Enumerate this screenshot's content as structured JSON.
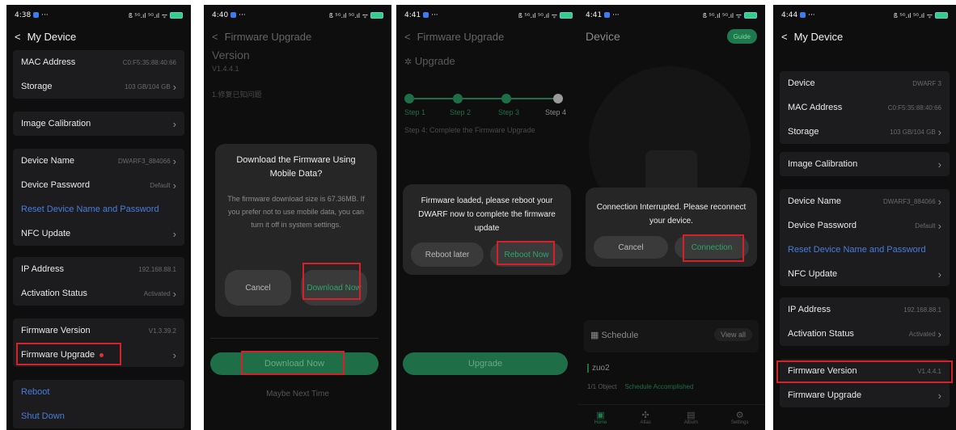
{
  "p1": {
    "time": "4:38",
    "status_right": "ß ⁵ᴳ.ıl ⁵ᴳ.ıl ᯤ",
    "title": "My Device",
    "mac_label": "MAC Address",
    "mac_value": "C0:F5:35:88:40:66",
    "storage_label": "Storage",
    "storage_value": "103 GB/104 GB",
    "calib_label": "Image Calibration",
    "devname_label": "Device Name",
    "devname_value": "DWARF3_884066",
    "devpw_label": "Device Password",
    "devpw_value": "Default",
    "reset_label": "Reset Device Name and Password",
    "nfc_label": "NFC Update",
    "ip_label": "IP Address",
    "ip_value": "192.168.88.1",
    "act_label": "Activation Status",
    "act_value": "Activated",
    "fwver_label": "Firmware Version",
    "fwver_value": "V1.3.39.2",
    "fwup_label": "Firmware Upgrade",
    "reboot_label": "Reboot",
    "shutdown_label": "Shut Down"
  },
  "p2": {
    "time": "4:40",
    "status_right": "ß ⁵ᴳ.ıl ⁵ᴳ.ıl ᯤ",
    "title": "Firmware Upgrade",
    "version_label": "Version",
    "version_value": "V1.4.4.1",
    "note": "1.修复已知问题",
    "dialog_title": "Download the Firmware Using Mobile Data?",
    "dialog_body": "The firmware download size is 67.36MB. If you prefer not to use mobile data, you can turn it off in system settings.",
    "cancel": "Cancel",
    "download_now_dialog": "Download Now",
    "download_now": "Download Now",
    "maybe": "Maybe Next Time"
  },
  "p3": {
    "time": "4:41",
    "status_right": "ß ⁵ᴳ.ıl ⁵ᴳ.ıl ᯤ",
    "title": "Firmware Upgrade",
    "upgrade_heading": "Upgrade",
    "steps": [
      "Step 1",
      "Step 2",
      "Step 3",
      "Step 4"
    ],
    "step_desc": "Step 4: Complete the Firmware Upgrade",
    "dialog_text": "Firmware loaded, please reboot your DWARF now to complete the firmware update",
    "reboot_later": "Reboot later",
    "reboot_now": "Reboot Now",
    "upgrade_btn": "Upgrade"
  },
  "p4": {
    "time": "4:41",
    "status_right": "ß ⁵ᴳ.ıl ⁵ᴳ.ıl ᯤ",
    "title": "Device",
    "guide": "Guide",
    "dialog_text": "Connection Interrupted. Please reconnect your device.",
    "cancel": "Cancel",
    "connection": "Connection",
    "schedule": "Schedule",
    "view_all": "View all",
    "item_name": "zuo2",
    "item_obj": "1/1 Object",
    "item_status": "Schedule Accomplished",
    "tabs": [
      "Home",
      "Atlas",
      "Album",
      "Settings"
    ]
  },
  "p5": {
    "time": "4:44",
    "status_right": "ß ⁵ᴳ.ıl ⁵ᴳ.ıl ᯤ",
    "title": "My Device",
    "device_label": "Device",
    "device_value": "DWARF 3",
    "mac_label": "MAC Address",
    "mac_value": "C0:F5:35:88:40:66",
    "storage_label": "Storage",
    "storage_value": "103 GB/104 GB",
    "calib_label": "Image Calibration",
    "devname_label": "Device Name",
    "devname_value": "DWARF3_884066",
    "devpw_label": "Device Password",
    "devpw_value": "Default",
    "reset_label": "Reset Device Name and Password",
    "nfc_label": "NFC Update",
    "ip_label": "IP Address",
    "ip_value": "192.168.88.1",
    "act_label": "Activation Status",
    "act_value": "Activated",
    "fwver_label": "Firmware Version",
    "fwver_value": "V1.4.4.1",
    "fwup_label": "Firmware Upgrade"
  },
  "colors": {
    "accent_green": "#1e6f47",
    "link_blue": "#4a7cdc",
    "highlight_red": "#d8202a"
  }
}
